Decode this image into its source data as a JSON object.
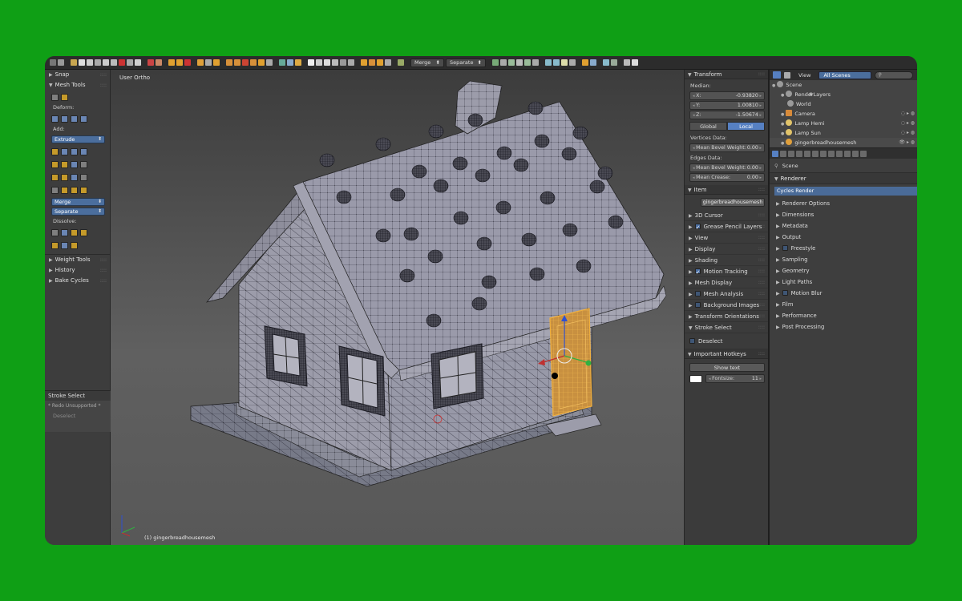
{
  "viewport": {
    "title": "User Ortho",
    "object_label": "(1) gingerbreadhousemesh"
  },
  "toolbar": {
    "merge_select": "Merge",
    "separate_select": "Separate"
  },
  "tool_shelf": {
    "snap": "Snap",
    "mesh_tools": "Mesh Tools",
    "deform_label": "Deform:",
    "add_label": "Add:",
    "extrude_select": "Extrude",
    "merge_select": "Merge",
    "separate_select": "Separate",
    "dissolve_label": "Dissolve:",
    "weight_tools": "Weight Tools",
    "history": "History",
    "bake_cycles": "Bake Cycles"
  },
  "operator_panel": {
    "title": "Stroke Select",
    "redo_note": "* Redo Unsupported *",
    "deselect": "Deselect"
  },
  "properties_panel": {
    "transform": "Transform",
    "median_label": "Median:",
    "x_label": "X:",
    "x_value": "-0.93820",
    "y_label": "Y:",
    "y_value": "1.00810",
    "z_label": "Z:",
    "z_value": "-1.50674",
    "global": "Global",
    "local": "Local",
    "vertices_data": "Vertices Data:",
    "mean_bevel_weight_label": "Mean Bevel Weight:",
    "vertex_bevel_value": "0.00",
    "edges_data": "Edges Data:",
    "edge_bevel_label": "Mean Bevel Weight:",
    "edge_bevel_value": "0.00",
    "mean_crease_label": "Mean Crease:",
    "mean_crease_value": "0.00",
    "item": "Item",
    "item_name": "gingerbreadhousemesh",
    "sections": {
      "cursor": "3D Cursor",
      "grease_pencil": "Grease Pencil Layers",
      "view": "View",
      "display": "Display",
      "shading": "Shading",
      "motion_tracking": "Motion Tracking",
      "mesh_display": "Mesh Display",
      "mesh_analysis": "Mesh Analysis",
      "background_images": "Background Images",
      "transform_orientations": "Transform Orientations",
      "stroke_select": "Stroke Select"
    },
    "deselect": "Deselect",
    "important_hotkeys": "Important Hotkeys",
    "show_text": "Show text",
    "fontsize_label": "Fontsize:",
    "fontsize_value": "11"
  },
  "outliner": {
    "view_menu": "View",
    "scenes_select": "All Scenes",
    "items": {
      "scene": "Scene",
      "renderlayers": "RenderLayers",
      "world": "World",
      "camera": "Camera",
      "lamp_hemi": "Lamp Hemi",
      "lamp_sun": "Lamp Sun",
      "mesh": "gingerbreadhousemesh"
    }
  },
  "render_properties": {
    "scene_label": "Scene",
    "renderer": "Renderer",
    "engine": "Cycles Render",
    "sections": {
      "renderer_options": "Renderer Options",
      "dimensions": "Dimensions",
      "metadata": "Metadata",
      "output": "Output",
      "freestyle": "Freestyle",
      "sampling": "Sampling",
      "geometry": "Geometry",
      "light_paths": "Light Paths",
      "motion_blur": "Motion Blur",
      "film": "Film",
      "performance": "Performance",
      "post_processing": "Post Processing"
    }
  },
  "colors": {
    "background": "#0f9f15",
    "selection_orange": "#e8a035",
    "accent_blue": "#5680c2"
  }
}
